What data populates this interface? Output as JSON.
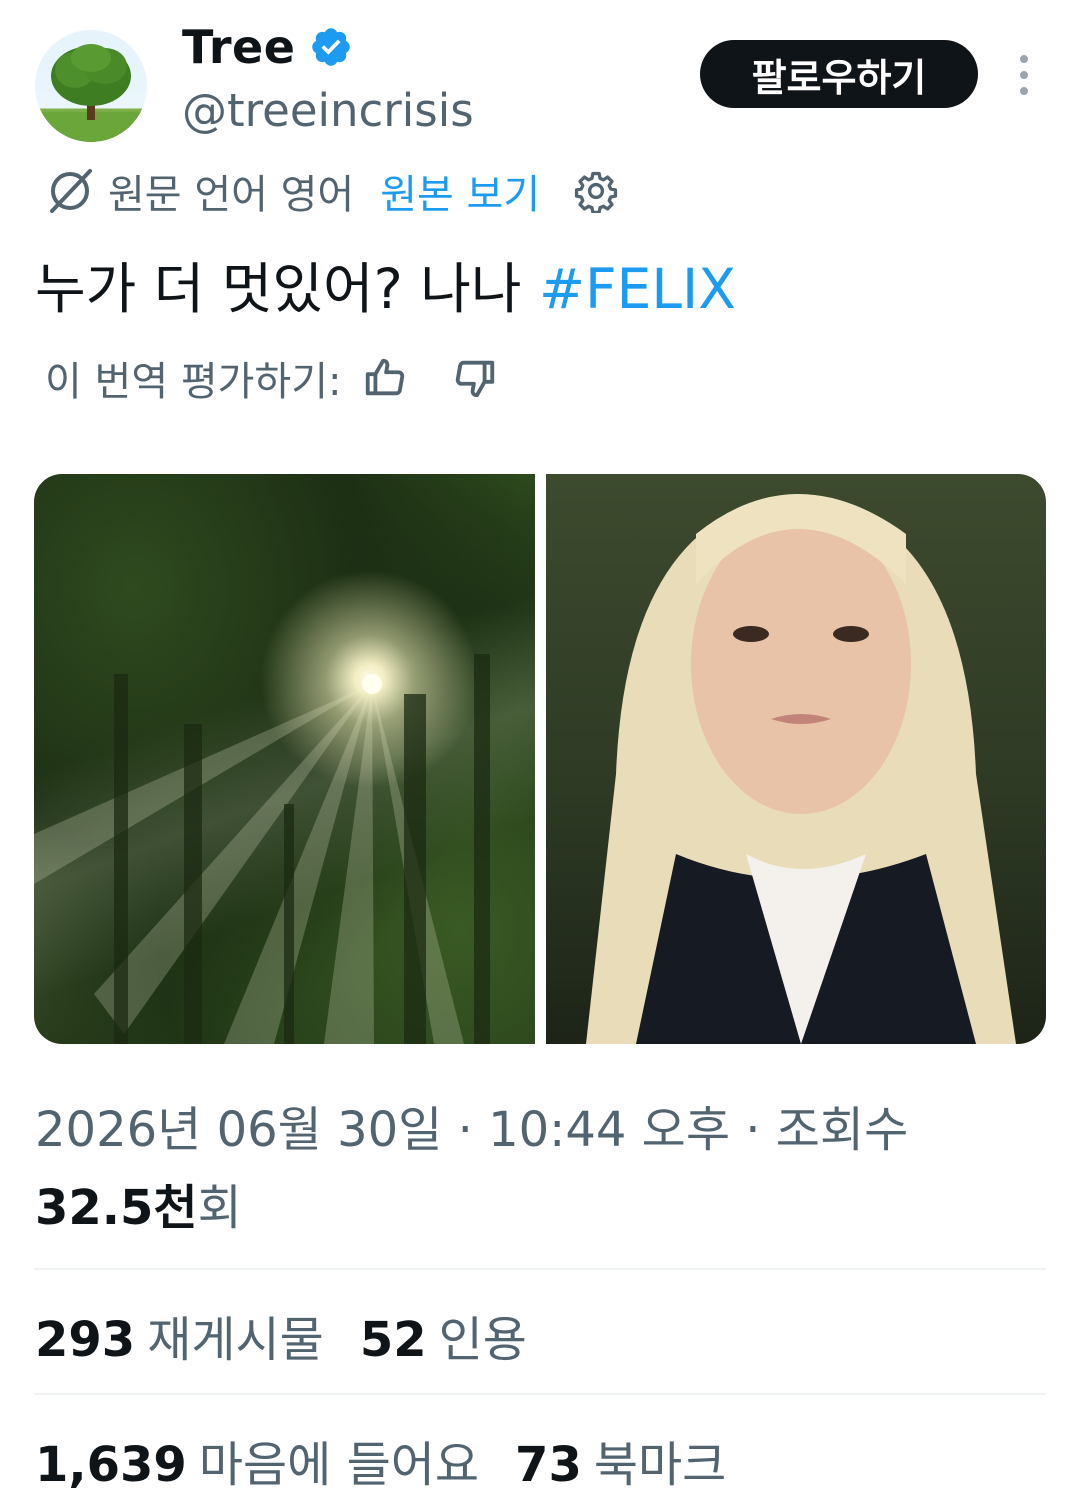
{
  "author": {
    "name": "Tree",
    "handle": "@treeincrisis",
    "verified_color": "#1d9bf0"
  },
  "follow_button": {
    "label": "팔로우하기"
  },
  "more_menu": {
    "icon": "more-vertical-icon"
  },
  "translation": {
    "label": "원문 언어 영어",
    "view_original": "원본 보기",
    "icon": "translate-icon",
    "settings_icon": "gear-icon"
  },
  "tweet": {
    "text": "누가 더 멋있어? 나나 ",
    "hashtag": "#FELIX"
  },
  "rating": {
    "label": "이 번역 평가하기:",
    "thumbs_up_icon": "thumbs-up-icon",
    "thumbs_down_icon": "thumbs-down-icon"
  },
  "media": [
    {
      "name": "forest-sunlight-photo"
    },
    {
      "name": "portrait-photo"
    }
  ],
  "meta": {
    "datetime": "2026년 06월 30일 · 10:44 오후 · 조회수",
    "views_number": "32.5천",
    "views_suffix": "회"
  },
  "stats": {
    "reposts_count": "293",
    "reposts_label": "재게시물",
    "quotes_count": "52",
    "quotes_label": "인용",
    "likes_count": "1,639",
    "likes_label": "마음에 들어요",
    "bookmarks_count": "73",
    "bookmarks_label": "북마크"
  },
  "colors": {
    "text": "#0f1419",
    "secondary": "#536471",
    "accent": "#1d9bf0",
    "button_bg": "#0f1419"
  }
}
